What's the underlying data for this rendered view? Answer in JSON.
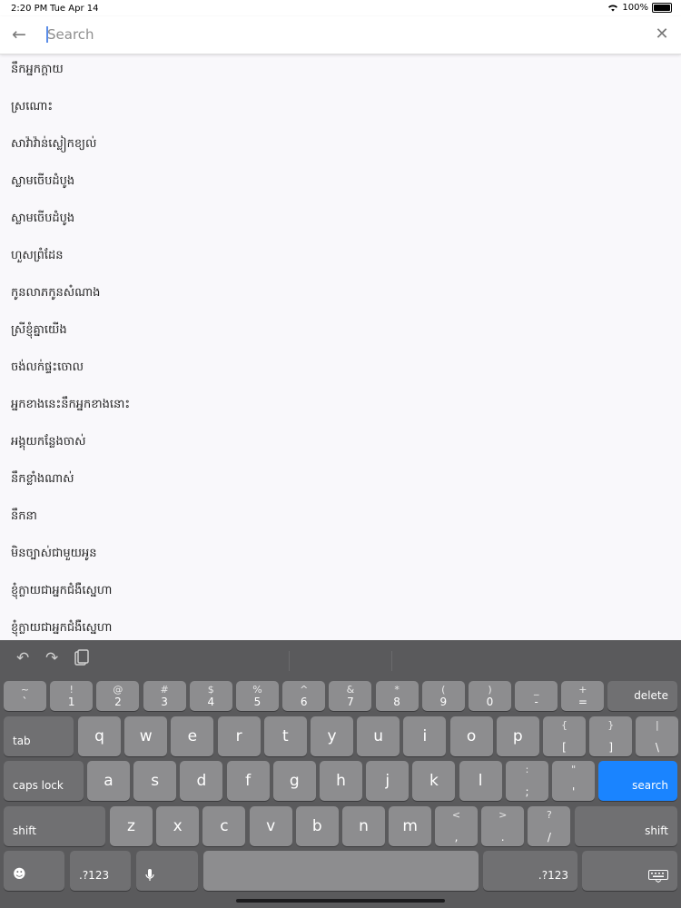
{
  "status": {
    "time": "2:20 PM",
    "date": "Tue Apr 14",
    "battery": "100%"
  },
  "search": {
    "placeholder": "Search",
    "value": ""
  },
  "icons": {
    "back": "arrow-left-icon",
    "close": "close-icon",
    "undo": "undo-icon",
    "redo": "redo-icon",
    "paste": "paste-icon",
    "emoji": "emoji-icon",
    "mic": "microphone-icon",
    "hide_keyboard": "hide-keyboard-icon",
    "wifi": "wifi-icon"
  },
  "results": [
    "នឹកអ្នកក្តាយ",
    "ស្រណោះ",
    "សាវ៉ាវ៉ាន់ស្លៀកខ្យល់",
    "ស្លាមចេីបដំបូង",
    "ស្លាមចេីបដំបូង",
    "ហួសព្រំដែន",
    "កូនលាភកូនសំណាង",
    "ស្រីខ្ញុំគ្នាយើង",
    "ចង់លក់ផ្ទះចោល",
    "អ្នកខាងនេះនឹកអ្នកខាងនោះ",
    "អង្គុយកន្លែងចាស់",
    "នឹកខ្លាំងណាស់",
    "នឹកនា",
    "មិនច្បាស់ជាមួយអូន",
    "ខ្ញុំក្លាយជាអ្នកជំងឺស្នេហា",
    "ខ្ញុំក្លាយជាអ្នកជំងឺស្នេហា"
  ],
  "keyboard": {
    "row1": [
      {
        "top": "~",
        "bottom": "`"
      },
      {
        "top": "!",
        "bottom": "1"
      },
      {
        "top": "@",
        "bottom": "2"
      },
      {
        "top": "#",
        "bottom": "3"
      },
      {
        "top": "$",
        "bottom": "4"
      },
      {
        "top": "%",
        "bottom": "5"
      },
      {
        "top": "^",
        "bottom": "6"
      },
      {
        "top": "&",
        "bottom": "7"
      },
      {
        "top": "*",
        "bottom": "8"
      },
      {
        "top": "(",
        "bottom": "9"
      },
      {
        "top": ")",
        "bottom": "0"
      },
      {
        "top": "_",
        "bottom": "-"
      },
      {
        "top": "+",
        "bottom": "="
      }
    ],
    "delete": "delete",
    "tab": "tab",
    "row2": [
      "q",
      "w",
      "e",
      "r",
      "t",
      "y",
      "u",
      "i",
      "o",
      "p"
    ],
    "row2_sym": [
      {
        "top": "{",
        "bottom": "["
      },
      {
        "top": "}",
        "bottom": "]"
      },
      {
        "top": "|",
        "bottom": "\\"
      }
    ],
    "caps": "caps lock",
    "row3": [
      "a",
      "s",
      "d",
      "f",
      "g",
      "h",
      "j",
      "k",
      "l"
    ],
    "row3_sym": [
      {
        "top": ":",
        "bottom": ";"
      },
      {
        "top": "\"",
        "bottom": "'"
      }
    ],
    "search": "search",
    "shift": "shift",
    "row4": [
      "z",
      "x",
      "c",
      "v",
      "b",
      "n",
      "m"
    ],
    "row4_sym": [
      {
        "top": "<",
        "bottom": ","
      },
      {
        "top": ">",
        "bottom": "."
      },
      {
        "top": "?",
        "bottom": "/"
      }
    ],
    "num_label": ".?123",
    "colors": {
      "accent": "#1a84ff",
      "key": "#8d8d8f",
      "key_dark": "#707072",
      "background": "#5a5a5c"
    }
  }
}
